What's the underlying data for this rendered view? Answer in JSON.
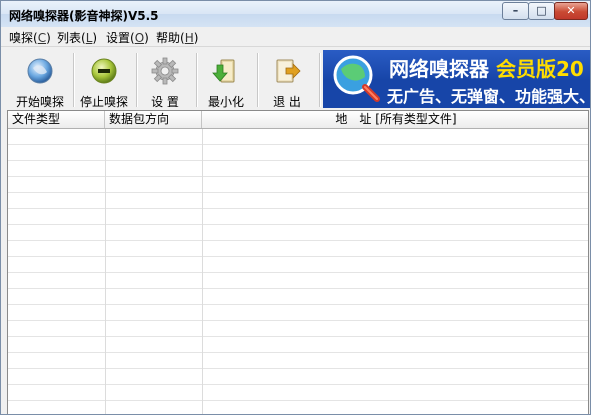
{
  "window": {
    "title": "网络嗅探器(影音神探)V5.5",
    "controls": {
      "minimize": "–",
      "maximize": "□",
      "close": "✕"
    }
  },
  "menu": [
    {
      "label": "嗅探(",
      "accel": "C",
      "suffix": ")"
    },
    {
      "label": "列表(",
      "accel": "L",
      "suffix": ")"
    },
    {
      "label": "设置(",
      "accel": "O",
      "suffix": ")"
    },
    {
      "label": "帮助(",
      "accel": "H",
      "suffix": ")"
    }
  ],
  "toolbar": {
    "start": {
      "label": "开始嗅探",
      "icon": "globe-icon"
    },
    "stop": {
      "label": "停止嗅探",
      "icon": "stop-icon"
    },
    "settings": {
      "label": "设 置",
      "icon": "gear-icon"
    },
    "minimize": {
      "label": "最小化",
      "icon": "minimize-tray-icon"
    },
    "exit": {
      "label": "退 出",
      "icon": "exit-door-icon"
    }
  },
  "banner": {
    "title_main": "网络嗅探器",
    "title_vip": "会员版20",
    "subtitle": "无广告、无弹窗、功能强大、全"
  },
  "list": {
    "columns": [
      {
        "label": "文件类型"
      },
      {
        "label": "数据包方向"
      },
      {
        "label": "地　址  [所有类型文件]"
      }
    ],
    "rows": []
  },
  "colors": {
    "banner_bg": "#1745a8",
    "banner_vip": "#ffdd00",
    "window_bg": "#f0f0f0"
  }
}
